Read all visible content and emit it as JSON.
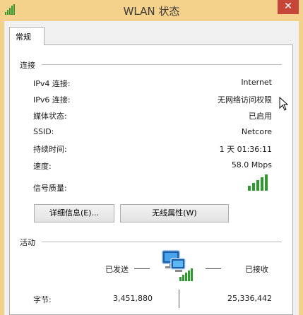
{
  "window": {
    "title": "WLAN 状态",
    "close_label": "✕"
  },
  "tabs": [
    {
      "label": "常规"
    }
  ],
  "connection": {
    "section_label": "连接",
    "rows": [
      {
        "label": "IPv4 连接:",
        "value": "Internet"
      },
      {
        "label": "IPv6 连接:",
        "value": "无网络访问权限"
      },
      {
        "label": "媒体状态:",
        "value": "已启用"
      },
      {
        "label": "SSID:",
        "value": "Netcore"
      },
      {
        "label": "持续时间:",
        "value": "1 天 01:36:11"
      },
      {
        "label": "速度:",
        "value": "58.0 Mbps"
      },
      {
        "label": "信号质量:",
        "value": ""
      }
    ],
    "signal_bars": 5,
    "signal_level": 5
  },
  "buttons": {
    "details_label": "详细信息(E)...",
    "wireless_props_label": "无线属性(W)"
  },
  "activity": {
    "section_label": "活动",
    "sent_label": "已发送",
    "received_label": "已接收",
    "bytes_label": "字节:",
    "bytes_sent": "3,451,880",
    "bytes_received": "25,336,442"
  },
  "icons": {
    "title": "wifi-signal-icon",
    "signal": "signal-strength-icon",
    "network": "network-computers-icon",
    "cursor": "mouse-cursor-icon"
  },
  "colors": {
    "signal_green": "#2e9a2e",
    "titlebar": "#f4d28c",
    "close": "#c7463a"
  }
}
